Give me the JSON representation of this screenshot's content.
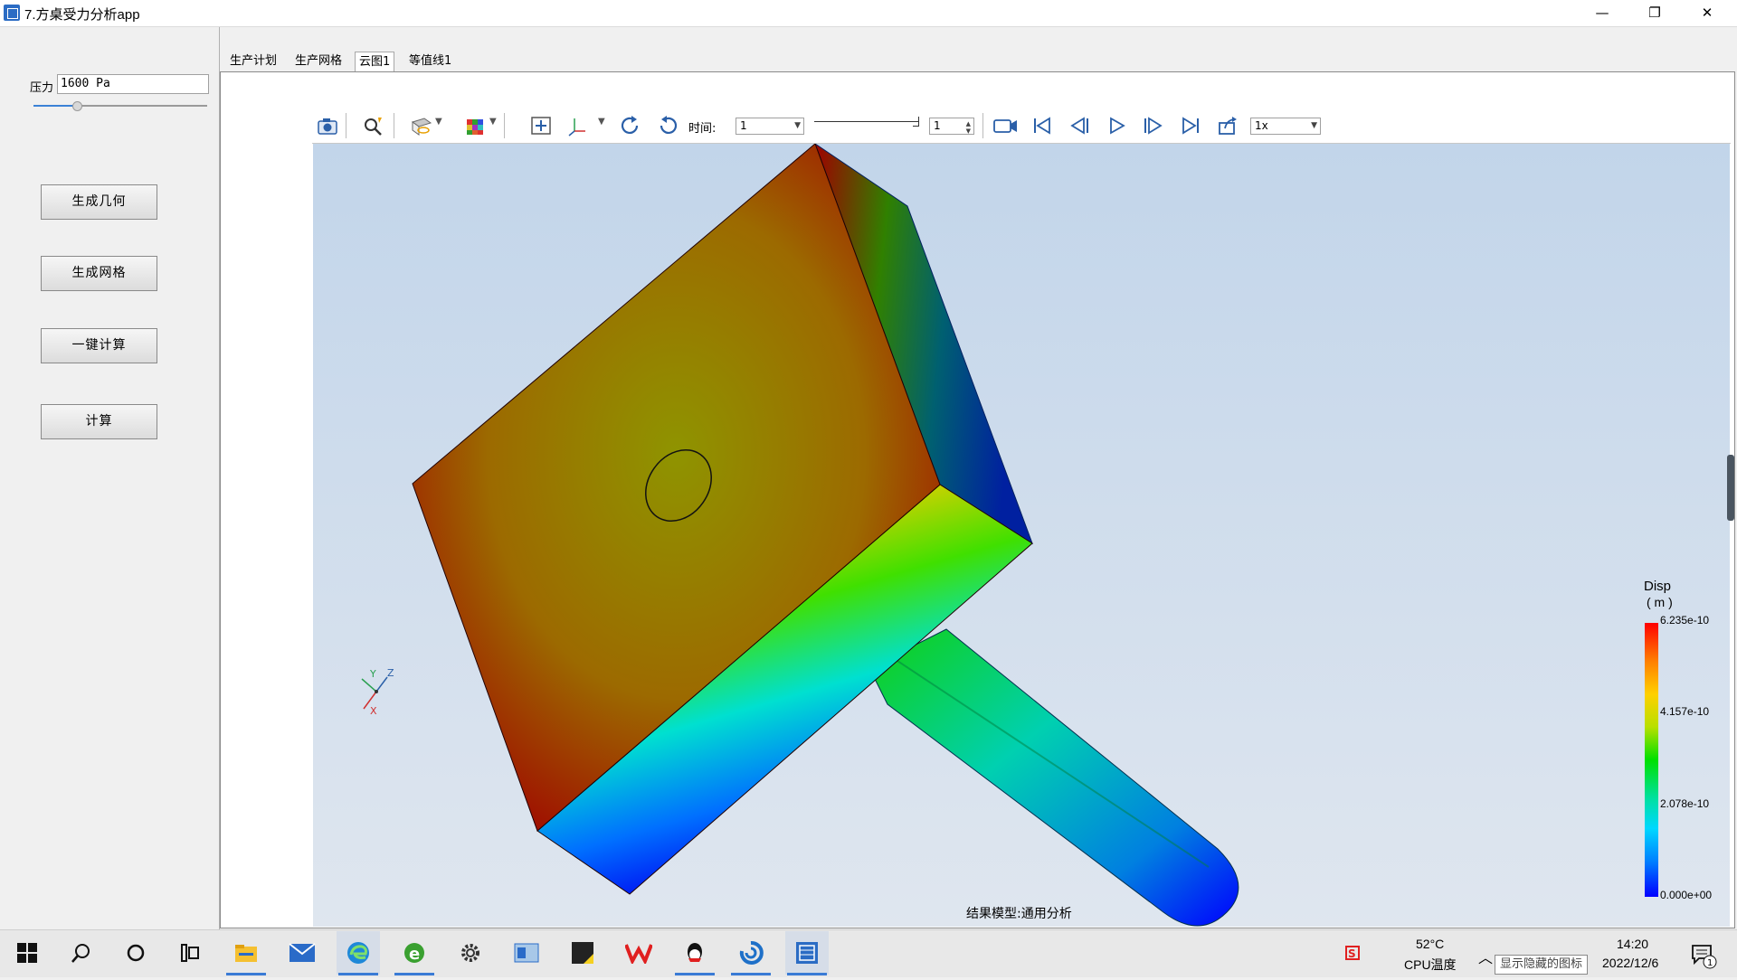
{
  "window": {
    "title": "7.方桌受力分析app",
    "controls": {
      "minimize": "—",
      "maximize": "❐",
      "close": "✕"
    }
  },
  "left_panel": {
    "pressure_label": "压力",
    "pressure_value": "1600 Pa",
    "pressure_slider_fraction": 0.25,
    "buttons": {
      "generate_geometry": "生成几何",
      "generate_mesh": "生成网格",
      "one_click_compute": "一键计算",
      "compute": "计算"
    }
  },
  "tabs": [
    {
      "label": "生产计划",
      "active": false
    },
    {
      "label": "生产网格",
      "active": false
    },
    {
      "label": "云图1",
      "active": true
    },
    {
      "label": "等值线1",
      "active": false
    }
  ],
  "toolbar": {
    "time_label": "时间:",
    "time_value": "1",
    "frame_value": "1",
    "speed_value": "1x",
    "icons": [
      "camera-icon",
      "zoom-icon",
      "display-mode-icon",
      "color-cube-icon",
      "fit-view-icon",
      "axes-icon",
      "rotate-cw-icon",
      "rotate-ccw-icon",
      "record-icon",
      "first-frame-icon",
      "prev-frame-icon",
      "play-icon",
      "next-frame-icon",
      "last-frame-icon",
      "export-icon"
    ]
  },
  "viewport": {
    "result_model": "结果模型:通用分析",
    "axes_labels": {
      "x": "X",
      "y": "Y",
      "z": "Z"
    },
    "legend": {
      "title": "Disp",
      "unit": "( m )",
      "ticks": [
        "6.235e-10",
        "4.157e-10",
        "2.078e-10",
        "0.000e+00"
      ],
      "colors": {
        "max": "#ff0000",
        "mid": "#00e000",
        "min": "#0000ff"
      }
    }
  },
  "taskbar": {
    "apps": [
      "start-icon",
      "search-icon",
      "cortana-icon",
      "task-view-icon",
      "file-explorer-icon",
      "mail-icon",
      "edge-icon",
      "ie-icon",
      "settings-icon",
      "app-window-icon",
      "sticky-icon",
      "wps-icon",
      "qq-icon",
      "swirl-app-icon",
      "table-app-icon"
    ],
    "temperature": "52°C",
    "temperature_label": "CPU温度",
    "time": "14:20",
    "date": "2022/12/6",
    "hidden_icons_tooltip": "显示隐藏的图标",
    "notification_count": "1"
  }
}
